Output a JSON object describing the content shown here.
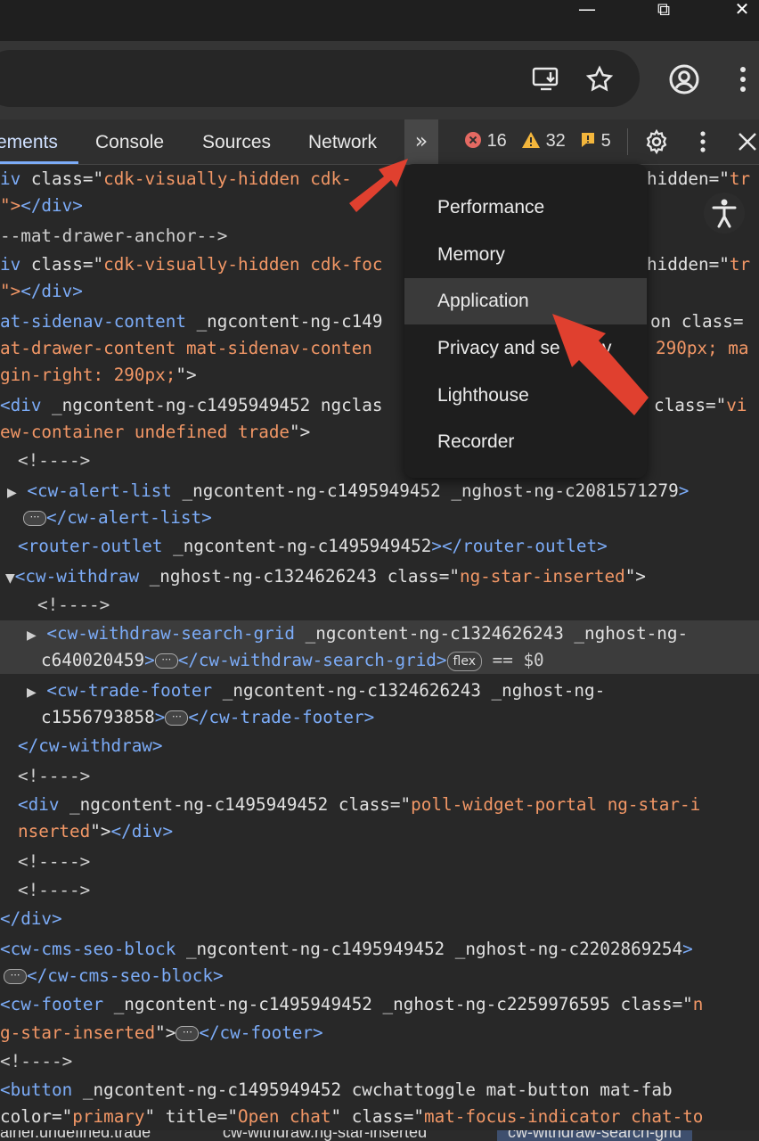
{
  "window": {
    "minimize": "—",
    "restore": "⧉",
    "close": "✕"
  },
  "toolbar": {
    "install_icon": "install-app-icon",
    "bookmark_icon": "star-icon",
    "profile_icon": "profile-icon",
    "menu_icon": "kebab-menu-icon"
  },
  "devtools": {
    "tabs": [
      {
        "label": "ements"
      },
      {
        "label": "Console"
      },
      {
        "label": "Sources"
      },
      {
        "label": "Network"
      }
    ],
    "more_tabs": "»",
    "errors": "16",
    "warnings": "32",
    "issues": "5",
    "accessibility_icon": "🚶"
  },
  "more_tabs_menu": {
    "items": [
      "Performance",
      "Memory",
      "Application",
      "Privacy and security",
      "Lighthouse",
      "Recorder"
    ],
    "selected": "Application",
    "visible_item4": "Privacy and se",
    "visible_item4_end": "y"
  },
  "dom": {
    "l1": {
      "a": "iv ",
      "b": "class",
      "c": "=\"",
      "d": "cdk-visually-hidden cdk-",
      "e": "hidden",
      "f": "=\"",
      "g": "tr"
    },
    "l2": {
      "a": "\">",
      "b": "</div>"
    },
    "l3": {
      "a": "--mat-drawer-anchor-->"
    },
    "l4": {
      "a": "iv ",
      "b": "class",
      "c": "=\"",
      "d": "cdk-visually-hidden cdk-foc",
      "e": "hidden",
      "f": "=\"",
      "g": "tr"
    },
    "l5": {
      "a": "\">",
      "b": "</div>"
    },
    "l6": {
      "a": "at-sidenav-content ",
      "b": "_ngcontent-ng-c149",
      "c": "on class=",
      "d": ""
    },
    "l7": {
      "a": "at-drawer-content mat-sidenav-conten",
      "b": "290px; ma"
    },
    "l8": {
      "a": "gin-right: 290px;",
      "b": "\">"
    },
    "l9": {
      "a": "<div ",
      "b": "_ngcontent-ng-c1495949452 ngclas",
      "c": "class",
      "d": "=\"",
      "e": "vi"
    },
    "l10": {
      "a": "ew-container undefined trade",
      "b": "\">"
    },
    "l11": {
      "a": "<!---->"
    },
    "l12": {
      "a": "<cw-alert-list ",
      "b": "_ngcontent-ng-c1495949452 _nghost-ng-c2081571279",
      "c": ">"
    },
    "l13": {
      "ell": "⋯",
      "b": "</cw-alert-list>"
    },
    "l14": {
      "a": "<router-outlet ",
      "b": "_ngcontent-ng-c1495949452",
      "c": "></router-outlet>"
    },
    "l15": {
      "a": "<cw-withdraw ",
      "b": "_nghost-ng-c1324626243 ",
      "c": "class",
      "d": "=\"",
      "e": "ng-star-inserted",
      "f": "\">"
    },
    "l16": {
      "a": "<!---->"
    },
    "l17": {
      "a": "<cw-withdraw-search-grid ",
      "b": "_ngcontent-ng-c1324626243 _nghost-ng-"
    },
    "l18": {
      "a": "c640020459",
      "b": ">",
      "ell": "⋯",
      "c": "</cw-withdraw-search-grid>",
      "flex": "flex",
      "d": " == $0"
    },
    "l19": {
      "a": "<cw-trade-footer ",
      "b": "_ngcontent-ng-c1324626243 _nghost-ng-"
    },
    "l20": {
      "a": "c1556793858",
      "b": ">",
      "ell": "⋯",
      "c": "</cw-trade-footer>"
    },
    "l21": {
      "a": "</cw-withdraw>"
    },
    "l22": {
      "a": "<!---->"
    },
    "l23": {
      "a": "<div ",
      "b": "_ngcontent-ng-c1495949452 ",
      "c": "class",
      "d": "=\"",
      "e": "poll-widget-portal ng-star-i"
    },
    "l24": {
      "a": "nserted",
      "b": "\">",
      "c": "</div>"
    },
    "l25": {
      "a": "<!---->"
    },
    "l26": {
      "a": "<!---->"
    },
    "l27": {
      "a": "</div>"
    },
    "l28": {
      "a": "<cw-cms-seo-block ",
      "b": "_ngcontent-ng-c1495949452 _nghost-ng-c2202869254",
      "c": ">"
    },
    "l29": {
      "ell": "⋯",
      "b": "</cw-cms-seo-block>"
    },
    "l30": {
      "a": "<cw-footer ",
      "b": "_ngcontent-ng-c1495949452 _nghost-ng-c2259976595 ",
      "c": "class",
      "d": "=\"",
      "e": "n"
    },
    "l31": {
      "a": "g-star-inserted",
      "b": "\">",
      "ell": "⋯",
      "c": "</cw-footer>"
    },
    "l32": {
      "a": "<!---->"
    },
    "l33": {
      "a": "<button ",
      "b": "_ngcontent-ng-c1495949452 cwchattoggle mat-button mat-fab"
    },
    "l34": {
      "a": "color",
      "b": "=\"",
      "c": "primary",
      "d": "\" title",
      "e": "=\"",
      "f": "Open chat",
      "g": "\" class",
      "h": "=\"",
      "i": "mat-focus-indicator chat-to"
    }
  },
  "breadcrumbs": {
    "items": [
      "ainer.undefined.trade",
      "cw-withdraw.ng-star-inserted",
      "cw-withdraw-search-grid"
    ]
  },
  "colors": {
    "tag": "#7cacf8",
    "value": "#f29766",
    "arrow": "#e53935",
    "selected_row": "#3c3c3c"
  }
}
